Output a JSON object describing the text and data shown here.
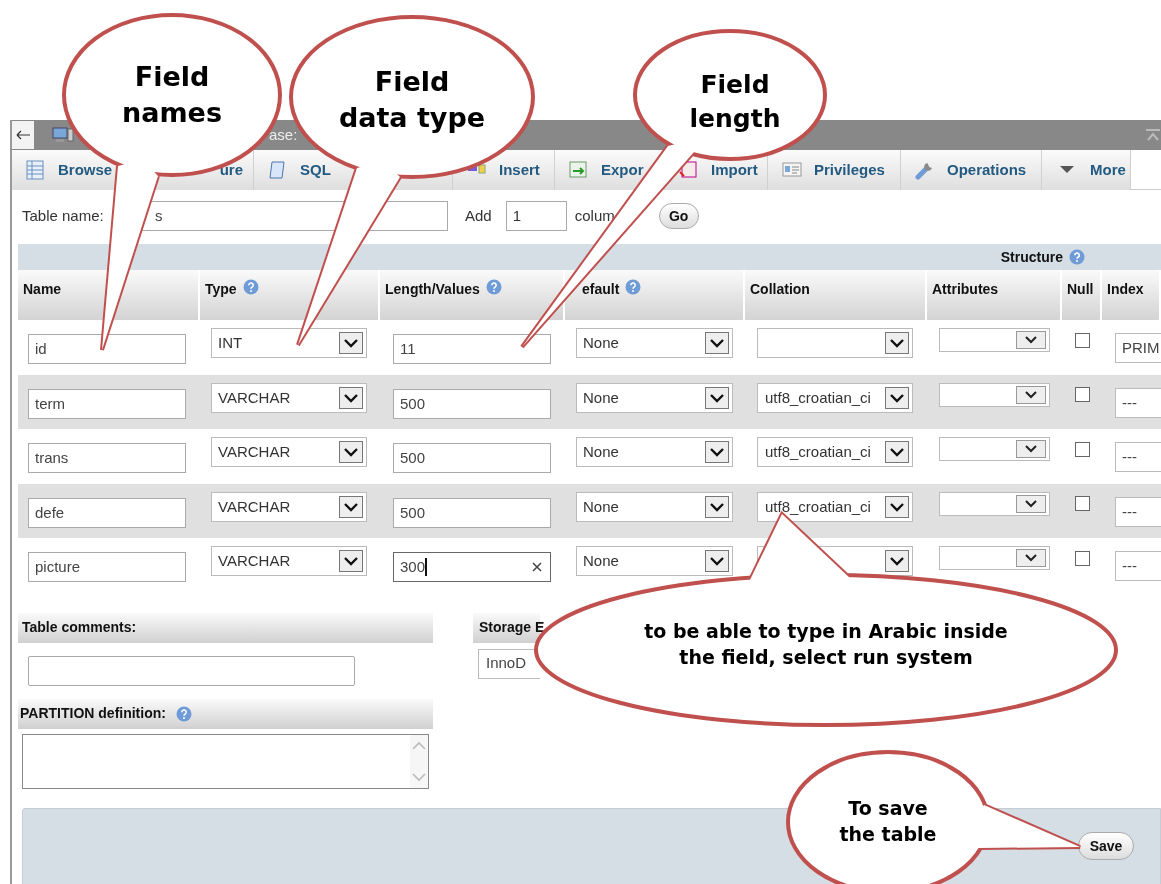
{
  "window": {
    "title": "ase:"
  },
  "tabs": [
    {
      "label": "Browse"
    },
    {
      "label": "ure"
    },
    {
      "label": "SQL"
    },
    {
      "label": "Insert"
    },
    {
      "label": "Expor"
    },
    {
      "label": "Import"
    },
    {
      "label": "Privileges"
    },
    {
      "label": "Operations"
    },
    {
      "label": "More"
    }
  ],
  "table_name": {
    "label": "Table name:",
    "value": "s"
  },
  "add_columns": {
    "label": "Add",
    "value": "1",
    "suffix": "colum",
    "button": "Go"
  },
  "structure": {
    "title": "Structure",
    "columns": [
      {
        "label": "Name",
        "help": false
      },
      {
        "label": "Type",
        "help": true
      },
      {
        "label": "Length/Values",
        "help": true
      },
      {
        "label": "efault",
        "help": true
      },
      {
        "label": "Collation",
        "help": false
      },
      {
        "label": "Attributes",
        "help": false
      },
      {
        "label": "Null",
        "help": false
      },
      {
        "label": "Index",
        "help": false
      }
    ],
    "rows": [
      {
        "name": "id",
        "type": "INT",
        "length": "11",
        "default": "None",
        "null": false,
        "index": "PRIM",
        "focused": false
      },
      {
        "name": "term",
        "type": "VARCHAR",
        "length": "500",
        "default": "None",
        "collation": "utf8_croatian_ci",
        "null": false,
        "index": "---",
        "focused": false
      },
      {
        "name": "trans",
        "type": "VARCHAR",
        "length": "500",
        "default": "None",
        "collation": "utf8_croatian_ci",
        "null": false,
        "index": "---",
        "focused": false
      },
      {
        "name": "defe",
        "type": "VARCHAR",
        "length": "500",
        "default": "None",
        "collation": "utf8_croatian_ci",
        "null": false,
        "index": "---",
        "focused": false
      },
      {
        "name": "picture",
        "type": "VARCHAR",
        "length": "300",
        "default": "None",
        "null": false,
        "index": "---",
        "focused": true
      }
    ]
  },
  "table_comments": {
    "label": "Table comments:"
  },
  "storage_engine": {
    "label": "Storage E",
    "value": "InnoD"
  },
  "partition": {
    "label": "PARTITION definition:"
  },
  "save_button": "Save",
  "callouts": [
    {
      "text": "Field\nnames"
    },
    {
      "text": "Field\ndata type"
    },
    {
      "text": "Field\nlength"
    },
    {
      "text": "to be able to type in Arabic inside\nthe  field, select run system"
    },
    {
      "text": "To save\nthe table"
    }
  ]
}
